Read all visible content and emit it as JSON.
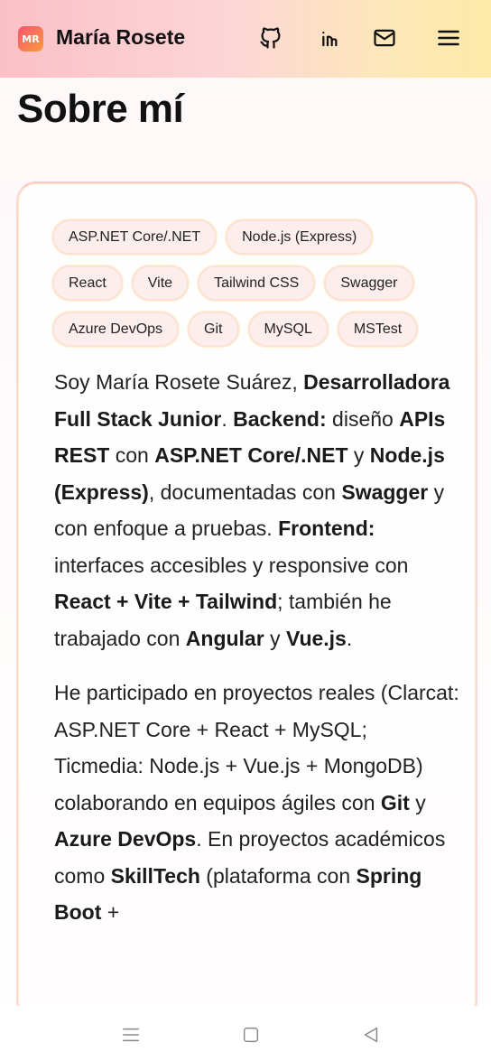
{
  "header": {
    "logo_text": "MR",
    "brand": "María Rosete",
    "icons": [
      "github-icon",
      "linkedin-icon",
      "mail-icon",
      "menu-icon"
    ]
  },
  "page": {
    "title": "Sobre mí"
  },
  "chips": [
    [
      "ASP.NET Core/.NET",
      "Node.js (Express)"
    ],
    [
      "React",
      "Vite",
      "Tailwind CSS",
      "Swagger"
    ],
    [
      "Azure DevOps",
      "Git",
      "MySQL",
      "MSTest"
    ]
  ],
  "bio": {
    "p1": [
      {
        "t": "Soy María Rosete Suárez, ",
        "b": false
      },
      {
        "t": "Desarrolladora Full Stack Junior",
        "b": true
      },
      {
        "t": ". ",
        "b": false
      },
      {
        "t": "Backend:",
        "b": true
      },
      {
        "t": " diseño ",
        "b": false
      },
      {
        "t": "APIs REST",
        "b": true
      },
      {
        "t": " con ",
        "b": false
      },
      {
        "t": "ASP.NET Core/.NET",
        "b": true
      },
      {
        "t": " y ",
        "b": false
      },
      {
        "t": "Node.js (Express)",
        "b": true
      },
      {
        "t": ", documentadas con ",
        "b": false
      },
      {
        "t": "Swagger",
        "b": true
      },
      {
        "t": " y con enfoque a pruebas. ",
        "b": false
      },
      {
        "t": "Frontend:",
        "b": true
      },
      {
        "t": " interfaces accesibles y responsive con ",
        "b": false
      },
      {
        "t": "React + Vite + Tailwind",
        "b": true
      },
      {
        "t": "; también he trabajado con ",
        "b": false
      },
      {
        "t": "Angular",
        "b": true
      },
      {
        "t": " y ",
        "b": false
      },
      {
        "t": "Vue.js",
        "b": true
      },
      {
        "t": ".",
        "b": false
      }
    ],
    "p2": [
      {
        "t": "He participado en proyectos reales (Clarcat: ASP.NET Core + React + MySQL; Ticmedia: Node.js + Vue.js + MongoDB) colaborando en equipos ágiles con ",
        "b": false
      },
      {
        "t": "Git",
        "b": true
      },
      {
        "t": " y ",
        "b": false
      },
      {
        "t": "Azure DevOps",
        "b": true
      },
      {
        "t": ". En proyectos académicos como ",
        "b": false
      },
      {
        "t": "SkillTech",
        "b": true
      },
      {
        "t": " (plataforma con ",
        "b": false
      },
      {
        "t": "Spring Boot",
        "b": true
      },
      {
        "t": " +",
        "b": false
      }
    ]
  },
  "system_nav": [
    "recents-icon",
    "home-icon",
    "back-icon"
  ],
  "colors": {
    "header_start": "#fbc0c6",
    "header_end": "#fde9a8",
    "logo_start": "#f7546f",
    "logo_end": "#f99b3b",
    "chip_bg": "#fdeeee",
    "card_border": "#fbd6da"
  }
}
